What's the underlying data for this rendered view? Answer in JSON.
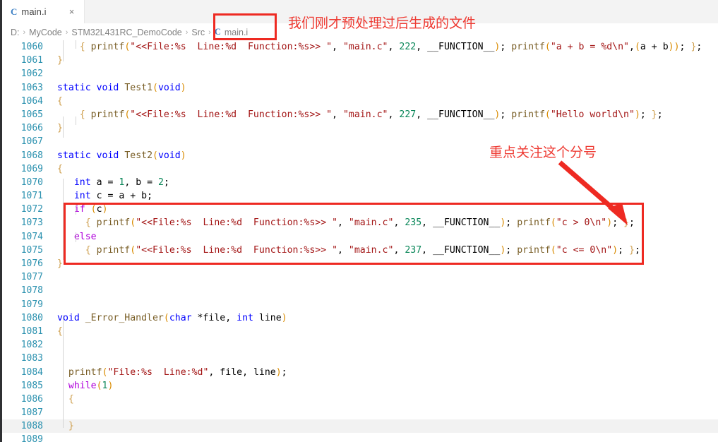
{
  "window": {
    "app": "vscode-editor"
  },
  "tab": {
    "icon": "c-file-icon",
    "label": "main.i",
    "close": "×"
  },
  "breadcrumb": {
    "separator": "›",
    "segments": [
      "D:",
      "MyCode",
      "STM32L431RC_DemoCode",
      "Src"
    ],
    "file_icon": "c-file-icon",
    "file": "main.i"
  },
  "annotations": {
    "top_note": "我们刚才预处理过后生成的文件",
    "mid_note": "重点关注这个分号",
    "color": "#ee3b33",
    "box_color": "#ee2a22"
  },
  "editor": {
    "first_line": 1060,
    "last_line": 1089,
    "current_line": 1088,
    "lines": [
      {
        "n": 1060,
        "text": "    { printf(\"<<File:%s  Line:%d  Function:%s>> \", \"main.c\", 222, __FUNCTION__); printf(\"a + b = %d\\n\",(a + b)); };"
      },
      {
        "n": 1061,
        "text": "}"
      },
      {
        "n": 1062,
        "text": ""
      },
      {
        "n": 1063,
        "text": "static void Test1(void)"
      },
      {
        "n": 1064,
        "text": "{"
      },
      {
        "n": 1065,
        "text": "    { printf(\"<<File:%s  Line:%d  Function:%s>> \", \"main.c\", 227, __FUNCTION__); printf(\"Hello world\\n\"); };"
      },
      {
        "n": 1066,
        "text": "}"
      },
      {
        "n": 1067,
        "text": ""
      },
      {
        "n": 1068,
        "text": "static void Test2(void)"
      },
      {
        "n": 1069,
        "text": "{"
      },
      {
        "n": 1070,
        "text": "   int a = 1, b = 2;"
      },
      {
        "n": 1071,
        "text": "   int c = a + b;"
      },
      {
        "n": 1072,
        "text": "   if (c)"
      },
      {
        "n": 1073,
        "text": "     { printf(\"<<File:%s  Line:%d  Function:%s>> \", \"main.c\", 235, __FUNCTION__); printf(\"c > 0\\n\"); };"
      },
      {
        "n": 1074,
        "text": "   else"
      },
      {
        "n": 1075,
        "text": "     { printf(\"<<File:%s  Line:%d  Function:%s>> \", \"main.c\", 237, __FUNCTION__); printf(\"c <= 0\\n\"); };"
      },
      {
        "n": 1076,
        "text": "}"
      },
      {
        "n": 1077,
        "text": ""
      },
      {
        "n": 1078,
        "text": ""
      },
      {
        "n": 1079,
        "text": ""
      },
      {
        "n": 1080,
        "text": "void _Error_Handler(char *file, int line)"
      },
      {
        "n": 1081,
        "text": "{"
      },
      {
        "n": 1082,
        "text": ""
      },
      {
        "n": 1083,
        "text": ""
      },
      {
        "n": 1084,
        "text": "  printf(\"File:%s  Line:%d\", file, line);"
      },
      {
        "n": 1085,
        "text": "  while(1)"
      },
      {
        "n": 1086,
        "text": "  {"
      },
      {
        "n": 1087,
        "text": ""
      },
      {
        "n": 1088,
        "text": "  }"
      },
      {
        "n": 1089,
        "text": ""
      }
    ]
  }
}
